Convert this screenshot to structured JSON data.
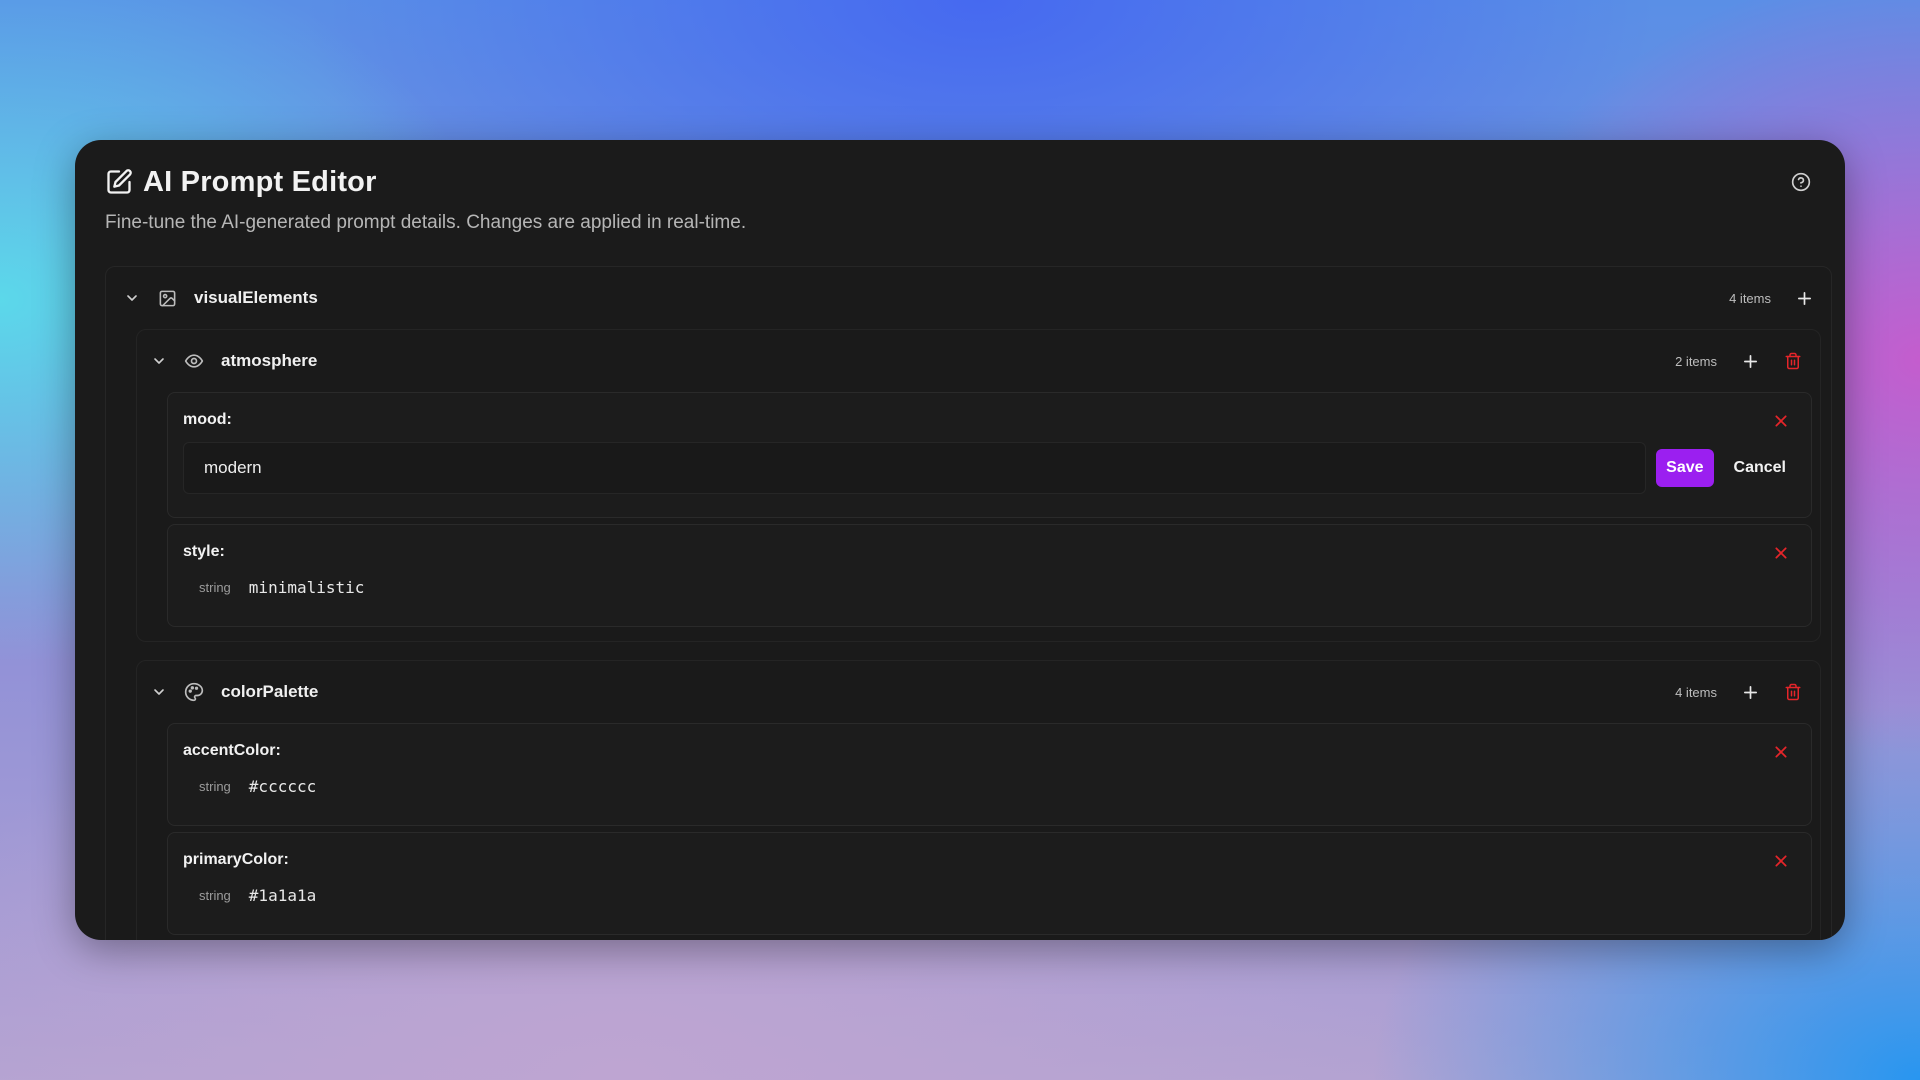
{
  "app": {
    "title": "AI Prompt Editor",
    "subtitle": "Fine-tune the AI-generated prompt details. Changes are applied in real-time.",
    "icons": {
      "title": "edit-icon",
      "help": "help-circle-icon"
    }
  },
  "tree": {
    "root": {
      "name": "visualElements",
      "count": "4 items",
      "icon": "image-icon",
      "children": [
        {
          "name": "atmosphere",
          "count": "2 items",
          "icon": "eye-icon",
          "entries": [
            {
              "key": "mood:",
              "editing": true,
              "value": "modern",
              "save_label": "Save",
              "cancel_label": "Cancel"
            },
            {
              "key": "style:",
              "type": "string",
              "value": "minimalistic"
            }
          ]
        },
        {
          "name": "colorPalette",
          "count": "4 items",
          "icon": "palette-icon",
          "entries": [
            {
              "key": "accentColor:",
              "type": "string",
              "value": "#cccccc"
            },
            {
              "key": "primaryColor:",
              "type": "string",
              "value": "#1a1a1a"
            }
          ]
        }
      ]
    }
  },
  "colors": {
    "accent": "#9b1ff0",
    "danger": "#e5252a",
    "panel": "#1b1b1b"
  }
}
